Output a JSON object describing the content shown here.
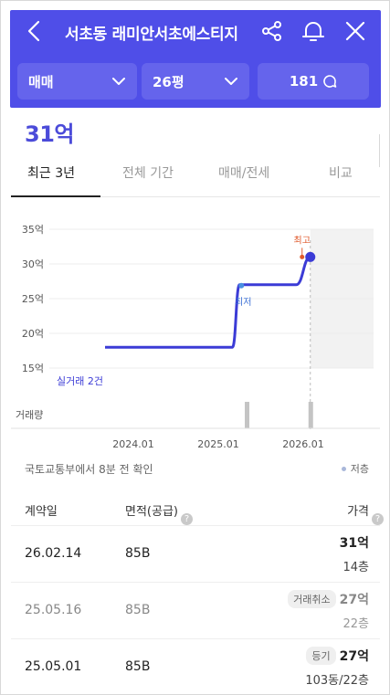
{
  "header": {
    "title": "서초동 래미안서초에스티지",
    "filters": {
      "trade_type": "매매",
      "size": "26평",
      "comments": "181"
    }
  },
  "price_summary": "31억",
  "tabs": [
    {
      "label": "최근 3년",
      "active": true
    },
    {
      "label": "전체 기간",
      "active": false
    },
    {
      "label": "매매/전세",
      "active": false
    },
    {
      "label": "비교",
      "active": false
    }
  ],
  "chart_data": {
    "type": "line",
    "y_ticks": [
      "35억",
      "30억",
      "25억",
      "20억",
      "15억"
    ],
    "ylim": [
      15,
      35
    ],
    "x_ticks": [
      "2024.01",
      "2025.01",
      "2026.01"
    ],
    "series": [
      {
        "points": [
          {
            "x": "2023.09",
            "y": 18
          },
          {
            "x": "2025.03",
            "y": 18
          },
          {
            "x": "2025.04",
            "y": 27
          },
          {
            "x": "2025.05",
            "y": 27
          },
          {
            "x": "2025.12",
            "y": 27
          },
          {
            "x": "2026.02",
            "y": 31
          }
        ]
      }
    ],
    "annotations": {
      "high": "최고",
      "low": "최저"
    },
    "trade_count_label": "실거래 2건",
    "volume_label": "거래량",
    "volume_bars": [
      "2025.05",
      "2026.02"
    ],
    "line_color": "#3b3bd6",
    "high_color": "#e05a2c"
  },
  "source_note": "국토교통부에서 8분 전 확인",
  "legend_label": "저층",
  "table": {
    "headers": {
      "date": "계약일",
      "area": "면적(공급)",
      "price": "가격"
    },
    "rows": [
      {
        "date": "26.02.14",
        "area": "85B",
        "badge": "",
        "price": "31억",
        "floor": "14층",
        "cancelled": false
      },
      {
        "date": "25.05.16",
        "area": "85B",
        "badge": "거래취소",
        "price": "27억",
        "floor": "22층",
        "cancelled": true
      },
      {
        "date": "25.05.01",
        "area": "85B",
        "badge": "등기",
        "price": "27억",
        "floor": "103동/22층",
        "cancelled": false
      }
    ]
  }
}
